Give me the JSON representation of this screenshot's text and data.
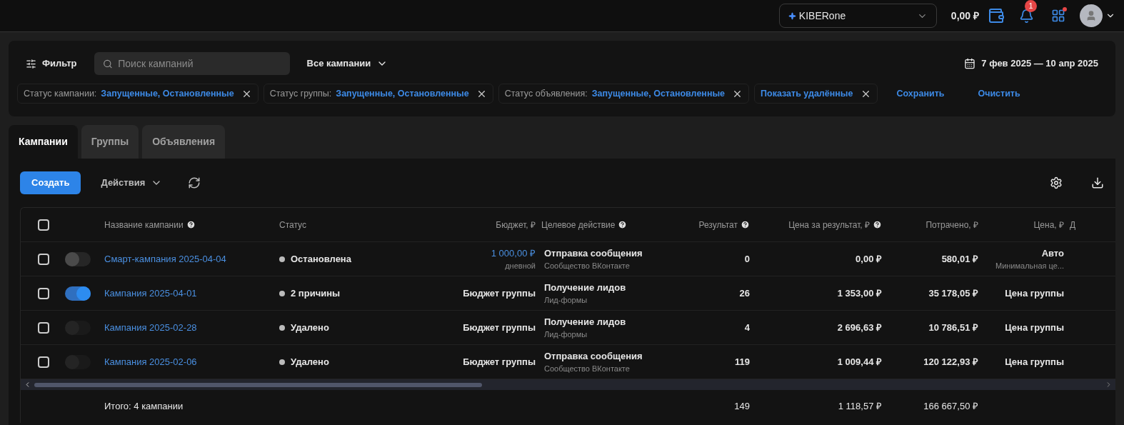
{
  "topbar": {
    "account": "KIBERone",
    "balance": "0,00 ₽",
    "notifications": "1"
  },
  "filter_bar": {
    "filter_button": "Фильтр",
    "search": {
      "placeholder": "Поиск кампаний"
    },
    "scope": "Все кампании",
    "date_range": "7 фев 2025 — 10 апр 2025",
    "chips": [
      {
        "label": "Статус кампании:",
        "value": "Запущенные, Остановленные"
      },
      {
        "label": "Статус группы:",
        "value": "Запущенные, Остановленные"
      },
      {
        "label": "Статус объявления:",
        "value": "Запущенные, Остановленные"
      },
      {
        "value": "Показать удалённые"
      }
    ],
    "actions": [
      "Сохранить",
      "Очистить"
    ]
  },
  "tabs": [
    {
      "label": "Кампании",
      "selected": true
    },
    {
      "label": "Группы",
      "selected": false
    },
    {
      "label": "Объявления",
      "selected": false
    }
  ],
  "toolbar": {
    "create": "Создать",
    "actions": "Действия"
  },
  "table": {
    "header_checked": false,
    "columns": [
      {
        "label": "Название кампании",
        "help": true
      },
      {
        "label": "Статус",
        "help": false
      },
      {
        "label": "Бюджет, ₽",
        "help": false
      },
      {
        "label": "Целевое действие",
        "help": true
      },
      {
        "label": "Результат",
        "help": true
      },
      {
        "label": "Цена за результат, ₽",
        "help": true
      },
      {
        "label": "Потрачено, ₽",
        "help": false
      },
      {
        "label": "Цена, ₽",
        "help": false
      },
      {
        "label": "Д",
        "help": false
      }
    ],
    "rows": [
      {
        "checked": false,
        "on": false,
        "disabled": false,
        "name": "Смарт-кампания 2025-04-04",
        "status": "Остановлена",
        "budget": "1 000,00 ₽",
        "budget_link": true,
        "budget_note": "дневной",
        "action": "Отправка сообщения",
        "action_note": "Сообщество ВКонтакте",
        "result": "0",
        "cost_per_result": "0,00 ₽",
        "spent": "580,01 ₽",
        "price": "Авто",
        "price_note": "Минимальная це..."
      },
      {
        "checked": false,
        "on": true,
        "disabled": false,
        "name": "Кампания 2025-04-01",
        "status": "2 причины",
        "budget": "Бюджет группы",
        "budget_link": false,
        "action": "Получение лидов",
        "action_note": "Лид-формы",
        "result": "26",
        "cost_per_result": "1 353,00 ₽",
        "spent": "35 178,05 ₽",
        "price": "Цена группы"
      },
      {
        "checked": false,
        "on": false,
        "disabled": true,
        "name": "Кампания 2025-02-28",
        "status": "Удалено",
        "budget": "Бюджет группы",
        "budget_link": false,
        "action": "Получение лидов",
        "action_note": "Лид-формы",
        "result": "4",
        "cost_per_result": "2 696,63 ₽",
        "spent": "10 786,51 ₽",
        "price": "Цена группы"
      },
      {
        "checked": false,
        "on": false,
        "disabled": true,
        "name": "Кампания 2025-02-06",
        "status": "Удалено",
        "budget": "Бюджет группы",
        "budget_link": false,
        "action": "Отправка сообщения",
        "action_note": "Сообщество ВКонтакте",
        "result": "119",
        "cost_per_result": "1 009,44 ₽",
        "spent": "120 122,93 ₽",
        "price": "Цена группы"
      }
    ],
    "total": {
      "label": "Итого: 4 кампании",
      "result": "149",
      "cost_per_result": "1 118,57 ₽",
      "spent": "166 667,50 ₽"
    }
  }
}
